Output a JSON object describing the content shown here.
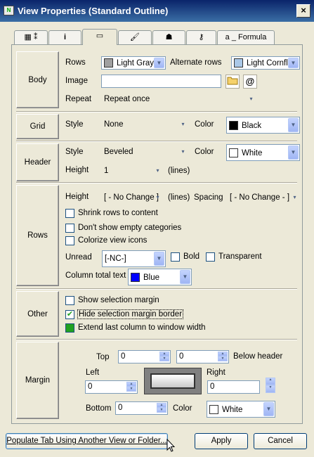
{
  "window": {
    "title": "View Properties (Standard Outline)",
    "close_label": "×"
  },
  "tabs": [
    {
      "name": "tab-columns",
      "label": "▦ ⁑"
    },
    {
      "name": "tab-info",
      "label": "i"
    },
    {
      "name": "tab-styles",
      "label": "▭"
    },
    {
      "name": "tab-brush",
      "label": "🖌"
    },
    {
      "name": "tab-hat",
      "label": "☗"
    },
    {
      "name": "tab-key",
      "label": "⚷"
    },
    {
      "name": "tab-formula",
      "label": "a _ Formula"
    }
  ],
  "body": {
    "section": "Body",
    "rows_label": "Rows",
    "rows_value": "Light Gray",
    "rows_color": "#a0a0a0",
    "alt_rows_label": "Alternate rows",
    "alt_rows_value": "Light Cornfl",
    "alt_rows_color": "#aac8e8",
    "image_label": "Image",
    "repeat_label": "Repeat",
    "repeat_value": "Repeat once"
  },
  "grid": {
    "section": "Grid",
    "style_label": "Style",
    "style_value": "None",
    "color_label": "Color",
    "color_value": "Black",
    "color_hex": "#000000"
  },
  "header": {
    "section": "Header",
    "style_label": "Style",
    "style_value": "Beveled",
    "color_label": "Color",
    "color_value": "White",
    "color_hex": "#ffffff",
    "height_label": "Height",
    "height_value": "1",
    "height_unit": "(lines)"
  },
  "rows": {
    "section": "Rows",
    "height_label": "Height",
    "height_value": "[ - No Change ]",
    "height_unit": "(lines)",
    "spacing_label": "Spacing",
    "spacing_value": "[ - No Change - ]",
    "shrink_label": "Shrink rows to content",
    "empty_label": "Don't show empty categories",
    "colorize_label": "Colorize view icons",
    "unread_label": "Unread",
    "unread_value": "[-NC-]",
    "bold_label": "Bold",
    "transparent_label": "Transparent",
    "total_label": "Column total text",
    "total_value": "Blue",
    "total_color": "#0000ff"
  },
  "other": {
    "section": "Other",
    "show_margin_label": "Show selection margin",
    "hide_border_label": "Hide selection margin border",
    "extend_label": "Extend last column to window width"
  },
  "margin": {
    "section": "Margin",
    "top_label": "Top",
    "top_value": "0",
    "below_value": "0",
    "below_label": "Below header",
    "left_label": "Left",
    "left_value": "0",
    "right_label": "Right",
    "right_value": "0",
    "bottom_label": "Bottom",
    "bottom_value": "0",
    "color_label": "Color",
    "color_value": "White",
    "color_hex": "#ffffff"
  },
  "footer": {
    "populate_label": "Populate Tab Using Another View or Folder...",
    "apply_label": "Apply",
    "cancel_label": "Cancel"
  }
}
